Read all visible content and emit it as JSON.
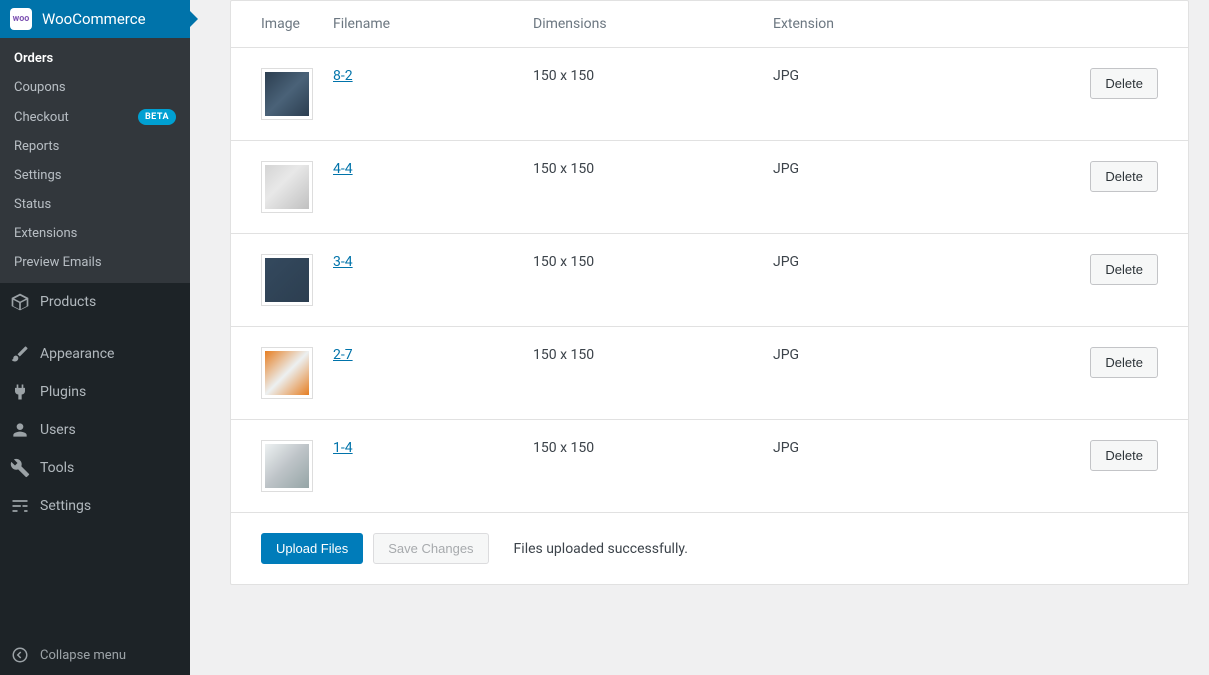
{
  "sidebar": {
    "section_title": "WooCommerce",
    "woo_badge": "woo",
    "submenu": [
      {
        "label": "Orders",
        "active": true
      },
      {
        "label": "Coupons"
      },
      {
        "label": "Checkout",
        "badge": "BETA"
      },
      {
        "label": "Reports"
      },
      {
        "label": "Settings"
      },
      {
        "label": "Status"
      },
      {
        "label": "Extensions"
      },
      {
        "label": "Preview Emails"
      }
    ],
    "menu": [
      {
        "label": "Products",
        "icon": "box"
      },
      {
        "label": "Appearance",
        "icon": "brush"
      },
      {
        "label": "Plugins",
        "icon": "plug"
      },
      {
        "label": "Users",
        "icon": "user"
      },
      {
        "label": "Tools",
        "icon": "wrench"
      },
      {
        "label": "Settings",
        "icon": "sliders"
      }
    ],
    "collapse_label": "Collapse menu"
  },
  "table": {
    "headers": {
      "image": "Image",
      "filename": "Filename",
      "dimensions": "Dimensions",
      "extension": "Extension"
    },
    "delete_label": "Delete",
    "rows": [
      {
        "filename": "8-2",
        "dimensions": "150 x 150",
        "extension": "JPG"
      },
      {
        "filename": "4-4",
        "dimensions": "150 x 150",
        "extension": "JPG"
      },
      {
        "filename": "3-4",
        "dimensions": "150 x 150",
        "extension": "JPG"
      },
      {
        "filename": "2-7",
        "dimensions": "150 x 150",
        "extension": "JPG"
      },
      {
        "filename": "1-4",
        "dimensions": "150 x 150",
        "extension": "JPG"
      }
    ]
  },
  "footer": {
    "upload_label": "Upload Files",
    "save_label": "Save Changes",
    "status_message": "Files uploaded successfully."
  }
}
